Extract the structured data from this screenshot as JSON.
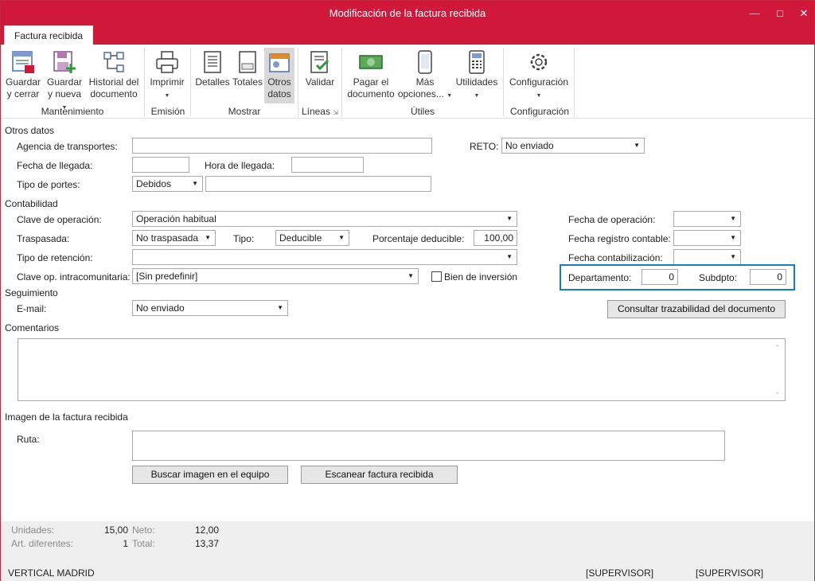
{
  "window": {
    "title": "Modificación de la factura recibida",
    "minimize": "—",
    "maximize": "□",
    "close": "✕"
  },
  "tabs": [
    "Factura recibida"
  ],
  "ribbon": {
    "guardar_cerrar": [
      "Guardar",
      "y cerrar"
    ],
    "guardar_nueva": [
      "Guardar",
      "y nueva"
    ],
    "historial": [
      "Historial del",
      "documento"
    ],
    "imprimir": "Imprimir",
    "detalles": "Detalles",
    "totales": "Totales",
    "otros_datos": [
      "Otros",
      "datos"
    ],
    "validar": "Validar",
    "pagar": [
      "Pagar el",
      "documento"
    ],
    "mas_opciones": [
      "Más",
      "opciones..."
    ],
    "utilidades": "Utilidades",
    "configuracion": "Configuración",
    "groups": {
      "mantenimiento": "Mantenimiento",
      "emision": "Emisión",
      "mostrar": "Mostrar",
      "lineas": "Líneas",
      "utiles": "Útiles",
      "configuracion": "Configuración"
    }
  },
  "otros_datos": {
    "title": "Otros datos",
    "agencia_label": "Agencia de transportes:",
    "agencia_value": "",
    "reto_label": "RETO:",
    "reto_value": "No enviado",
    "fecha_llegada_label": "Fecha de llegada:",
    "hora_llegada_label": "Hora de llegada:",
    "tipo_portes_label": "Tipo de portes:",
    "tipo_portes_value": "Debidos"
  },
  "contabilidad": {
    "title": "Contabilidad",
    "clave_operacion_label": "Clave de operación:",
    "clave_operacion_value": "Operación habitual",
    "traspasada_label": "Traspasada:",
    "traspasada_value": "No traspasada",
    "tipo_label": "Tipo:",
    "tipo_value": "Deducible",
    "porcentaje_label": "Porcentaje deducible:",
    "porcentaje_value": "100,00",
    "tipo_retencion_label": "Tipo de retención:",
    "clave_intra_label": "Clave op. intracomunitaria:",
    "clave_intra_value": "[Sin predefinir]",
    "bien_inversion_label": "Bien de inversión",
    "fecha_operacion_label": "Fecha de operación:",
    "fecha_registro_label": "Fecha registro contable:",
    "fecha_contab_label": "Fecha contabilización:",
    "departamento_label": "Departamento:",
    "departamento_value": "0",
    "subdpto_label": "Subdpto:",
    "subdpto_value": "0"
  },
  "seguimiento": {
    "title": "Seguimiento",
    "email_label": "E-mail:",
    "email_value": "No enviado",
    "trazabilidad_button": "Consultar trazabilidad del documento"
  },
  "comentarios": {
    "title": "Comentarios"
  },
  "imagen": {
    "title": "Imagen de la factura recibida",
    "ruta_label": "Ruta:",
    "buscar_button": "Buscar imagen en el equipo",
    "escanear_button": "Escanear factura recibida"
  },
  "footer": {
    "unidades_label": "Unidades:",
    "unidades_value": "15,00",
    "neto_label": "Neto:",
    "neto_value": "12,00",
    "art_label": "Art. diferentes:",
    "art_value": "1",
    "total_label": "Total:",
    "total_value": "13,37",
    "empresa": "VERTICAL MADRID",
    "user1": "[SUPERVISOR]",
    "user2": "[SUPERVISOR]"
  },
  "colors": {
    "accent": "#d0183b",
    "highlight": "#1c7bbf"
  }
}
